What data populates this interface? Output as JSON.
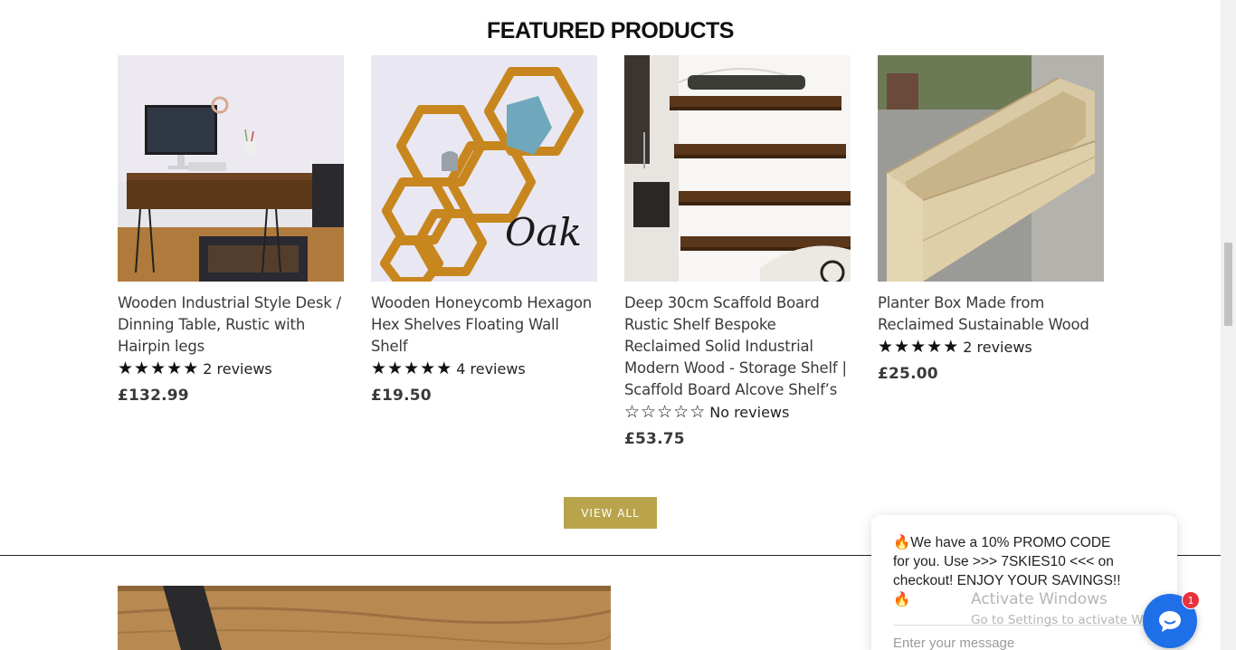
{
  "section": {
    "title": "FEATURED PRODUCTS"
  },
  "products": [
    {
      "title": "Wooden Industrial Style Desk / Dinning Table, Rustic with Hairpin legs",
      "rating": 5,
      "reviews_text": "2 reviews",
      "price": "£132.99",
      "image_icon": "desk-photo"
    },
    {
      "title": "Wooden Honeycomb Hexagon Hex Shelves Floating Wall Shelf",
      "rating": 5,
      "reviews_text": "4 reviews",
      "price": "£19.50",
      "image_icon": "hexagon-shelves-photo",
      "image_caption": "Oak"
    },
    {
      "title": "Deep 30cm Scaffold Board Rustic Shelf Bespoke Reclaimed Solid Industrial Modern Wood - Storage Shelf | Scaffold Board Alcove Shelf’s",
      "rating": 0,
      "reviews_text": "No reviews",
      "price": "£53.75",
      "image_icon": "alcove-shelves-photo"
    },
    {
      "title": "Planter Box Made from Reclaimed Sustainable Wood",
      "rating": 5,
      "reviews_text": "2 reviews",
      "price": "£25.00",
      "image_icon": "planter-box-photo"
    }
  ],
  "view_all_label": "VIEW ALL",
  "chat": {
    "message": "🔥We have a 10% PROMO CODE for you. Use >>> 7SKIES10 <<< on checkout! ENJOY YOUR SAVINGS!!🔥",
    "input_placeholder": "Enter your message",
    "badge_count": "1",
    "accent": "#1f6fe8"
  },
  "watermark": {
    "line1": "Activate Windows",
    "line2": "Go to Settings to activate Windows."
  },
  "colors": {
    "button": "#b9a44c",
    "badge": "#e8323c"
  }
}
